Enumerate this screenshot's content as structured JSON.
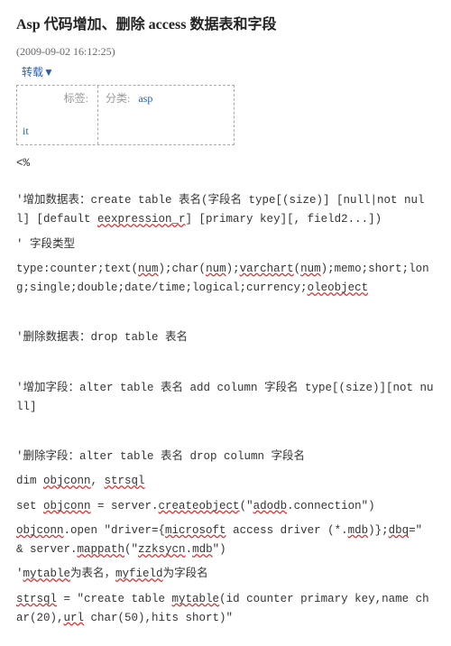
{
  "title": "Asp 代码增加、删除 access 数据表和字段",
  "timestamp": "(2009-09-02 16:12:25)",
  "repost": "转载▼",
  "meta": {
    "tag_label": "标签:",
    "tag_value": "it",
    "cat_label": "分类:",
    "cat_value": "asp"
  },
  "lines": {
    "l0": "<%",
    "l1a": "'增加数据表：create table 表名(字段名 type[(size)] [null|not null] [default ",
    "l1b": "eexpression_r",
    "l1c": "] [primary key][, field2...])",
    "l2": "' 字段类型",
    "l3a": "type:counter;text(",
    "l3b": "num",
    "l3c": ");char(",
    "l3d": "num",
    "l3e": ");",
    "l3f": "varchart",
    "l3g": "(",
    "l3h": "num",
    "l3i": ");memo;short;long;single;double;date/time;logical;currency;",
    "l3j": "oleobject",
    "l4": "'删除数据表：drop table 表名",
    "l5": "'增加字段：alter table 表名 add column 字段名 type[(size)][not null]",
    "l6": "'删除字段：alter table 表名 drop column 字段名",
    "l7a": "dim ",
    "l7b": "objconn",
    "l7c": ", ",
    "l7d": "strsql",
    "l8a": "set ",
    "l8b": "objconn",
    "l8c": " = server.",
    "l8d": "createobject",
    "l8e": "(\"",
    "l8f": "adodb",
    "l8g": ".connection\")",
    "l9a": "objconn",
    "l9b": ".open \"driver={",
    "l9c": "microsoft",
    "l9d": " access driver (*.",
    "l9e": "mdb",
    "l9f": ")};",
    "l9g": "dbq",
    "l9h": "=\" & server.",
    "l9i": "mappath",
    "l9j": "(\"",
    "l9k": "zzksycn",
    "l9l": ".",
    "l9m": "mdb",
    "l9n": "\")",
    "l10a": "'",
    "l10b": "mytable",
    "l10c": "为表名，",
    "l10d": "myfield",
    "l10e": "为字段名",
    "l11a": "strsql",
    "l11b": " = \"create table ",
    "l11c": "mytable",
    "l11d": "(id counter primary key,name char(20),",
    "l11e": "url",
    "l11f": " char(50),hits short)\""
  }
}
